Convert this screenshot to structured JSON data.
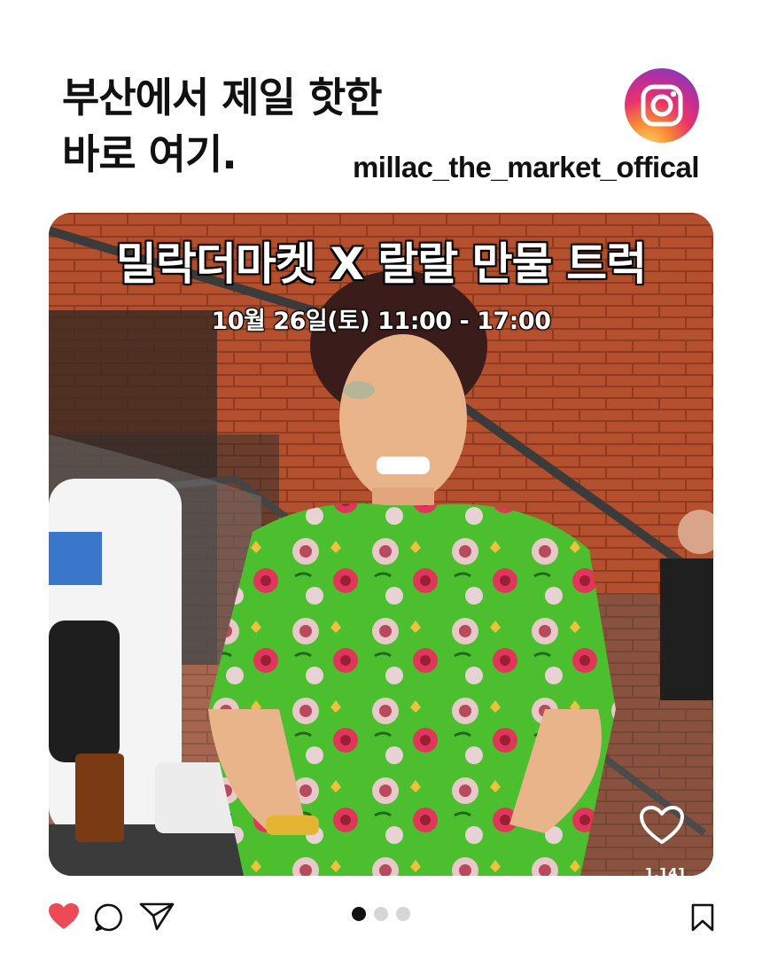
{
  "headline": {
    "line1": "부산에서 제일 핫한",
    "line2": "바로 여기."
  },
  "account": {
    "handle": "millac_the_market_offical",
    "logo_icon": "instagram-icon"
  },
  "post": {
    "overlay_title": "밀락더마켓 X 랄랄 만물 트럭",
    "overlay_subtitle": "10월 26일(토) 11:00 - 17:00",
    "like_count": "1,141"
  },
  "actions": {
    "like_icon": "heart-filled-icon",
    "comment_icon": "comment-bubble-icon",
    "share_icon": "send-icon",
    "save_icon": "bookmark-icon"
  },
  "carousel": {
    "total": 3,
    "active": 1
  },
  "colors": {
    "like_red": "#ed4956",
    "text": "#111111",
    "brick": "#b24d2b",
    "shirt_green": "#4cbf2f"
  }
}
